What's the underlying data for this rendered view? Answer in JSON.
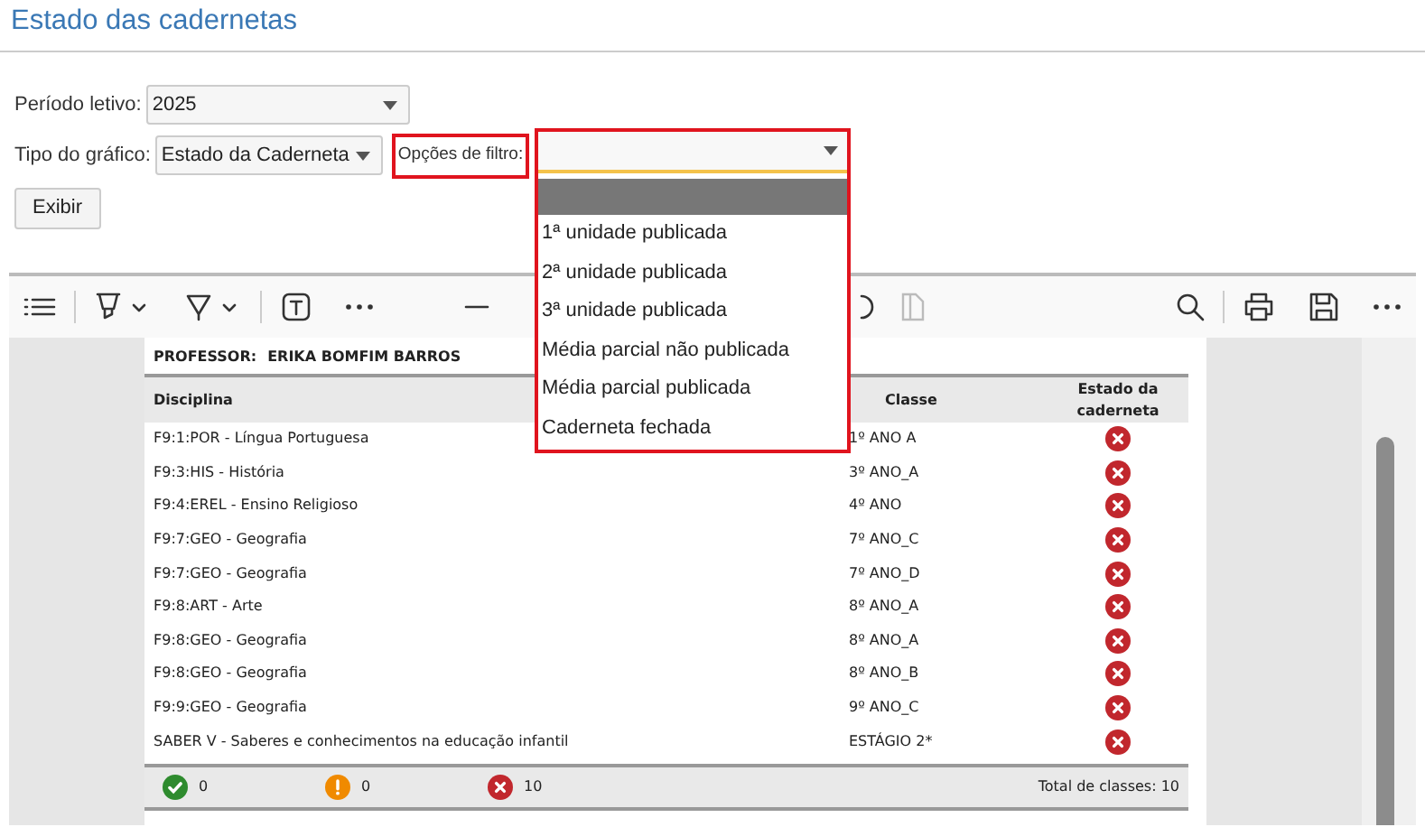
{
  "page_title": "Estado das cadernetas",
  "period": {
    "label": "Período letivo:",
    "value": "2025"
  },
  "chart_type": {
    "label": "Tipo do gráfico:",
    "value": "Estado da Caderneta"
  },
  "filter": {
    "label": "Opções de filtro:",
    "expanded": true,
    "blank_option_highlighted": true,
    "options": [
      {
        "label": "1ª unidade publicada",
        "selected": false
      },
      {
        "label": "2ª unidade publicada",
        "selected": false
      },
      {
        "label": "3ª unidade publicada",
        "selected": false
      },
      {
        "label": "Média parcial não publicada",
        "selected": false
      },
      {
        "label": "Média parcial publicada",
        "selected": false
      },
      {
        "label": "Caderneta fechada",
        "selected": false
      }
    ]
  },
  "show_button": "Exibir",
  "report": {
    "professor_label": "PROFESSOR:",
    "professor_name": "ERIKA BOMFIM BARROS",
    "columns": [
      "Disciplina",
      "Classe",
      "Estado da caderneta"
    ],
    "rows": [
      {
        "discipline": "F9:1:POR - Língua Portuguesa",
        "class": "1º ANO A",
        "kind": "error"
      },
      {
        "discipline": "F9:3:HIS - História",
        "class": "3º ANO_A",
        "kind": "error"
      },
      {
        "discipline": "F9:4:EREL - Ensino Religioso",
        "class": "4º ANO",
        "kind": "error"
      },
      {
        "discipline": "F9:7:GEO - Geografia",
        "class": "7º ANO_C",
        "kind": "error"
      },
      {
        "discipline": "F9:7:GEO - Geografia",
        "class": "7º ANO_D",
        "kind": "error"
      },
      {
        "discipline": "F9:8:ART - Arte",
        "class": "8º ANO_A",
        "kind": "error"
      },
      {
        "discipline": "F9:8:GEO - Geografia",
        "class": "8º ANO_A",
        "kind": "error"
      },
      {
        "discipline": "F9:8:GEO - Geografia",
        "class": "8º ANO_B",
        "kind": "error"
      },
      {
        "discipline": "F9:9:GEO - Geografia",
        "class": "9º ANO_C",
        "kind": "error"
      },
      {
        "discipline": "SABER V - Saberes e conhecimentos na educação infantil",
        "class": "ESTÁGIO 2*",
        "kind": "error"
      }
    ],
    "summary": [
      {
        "kind": "ok",
        "count": "0"
      },
      {
        "kind": "warning",
        "count": "0"
      },
      {
        "kind": "error",
        "count": "10"
      }
    ],
    "total": "Total de classes: 10"
  }
}
